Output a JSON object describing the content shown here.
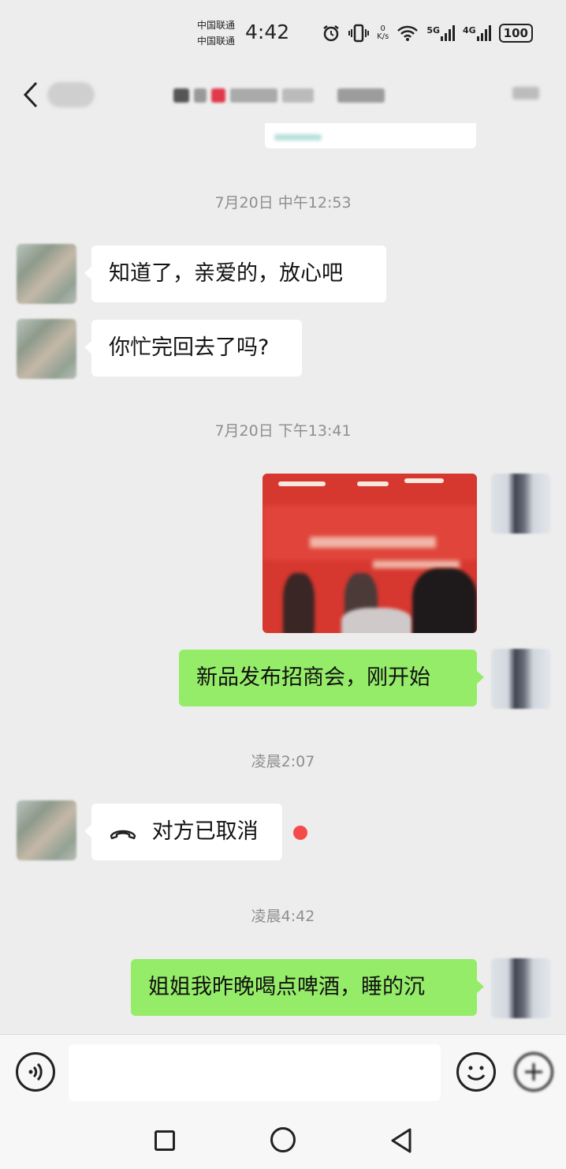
{
  "status_bar": {
    "carrier_1": "中国联通",
    "carrier_2": "中国联通",
    "time": "4:42",
    "net_speed_value": "0",
    "net_speed_unit": "K/s",
    "sim1_type": "5G",
    "sim2_type": "4G",
    "battery": "100"
  },
  "messages": [
    {
      "kind": "timestamp",
      "text": "7月20日 中午12:53"
    },
    {
      "kind": "text",
      "side": "in",
      "text": "知道了，亲爱的，放心吧"
    },
    {
      "kind": "text",
      "side": "in",
      "text": "你忙完回去了吗?"
    },
    {
      "kind": "timestamp",
      "text": "7月20日 下午13:41"
    },
    {
      "kind": "image",
      "side": "out"
    },
    {
      "kind": "text",
      "side": "out",
      "text": "新品发布招商会，刚开始"
    },
    {
      "kind": "timestamp",
      "text": "凌晨2:07"
    },
    {
      "kind": "call",
      "side": "in",
      "text": "对方已取消",
      "icon": "phone-hangup-icon",
      "unread": true
    },
    {
      "kind": "timestamp",
      "text": "凌晨4:42"
    },
    {
      "kind": "text",
      "side": "out",
      "text": "姐姐我昨晚喝点啤酒，睡的沉"
    }
  ],
  "colors": {
    "background": "#ededed",
    "incoming_bubble": "#ffffff",
    "outgoing_bubble": "#95ec69",
    "unread_dot": "#f44a4a",
    "timestamp": "#8e8e8e"
  },
  "input_bar": {
    "left_icon": "voice-icon",
    "right_icons": [
      "emoji-icon",
      "plus-icon"
    ]
  },
  "nav_bar": {
    "icons": [
      "recents-icon",
      "home-icon",
      "back-icon"
    ]
  }
}
